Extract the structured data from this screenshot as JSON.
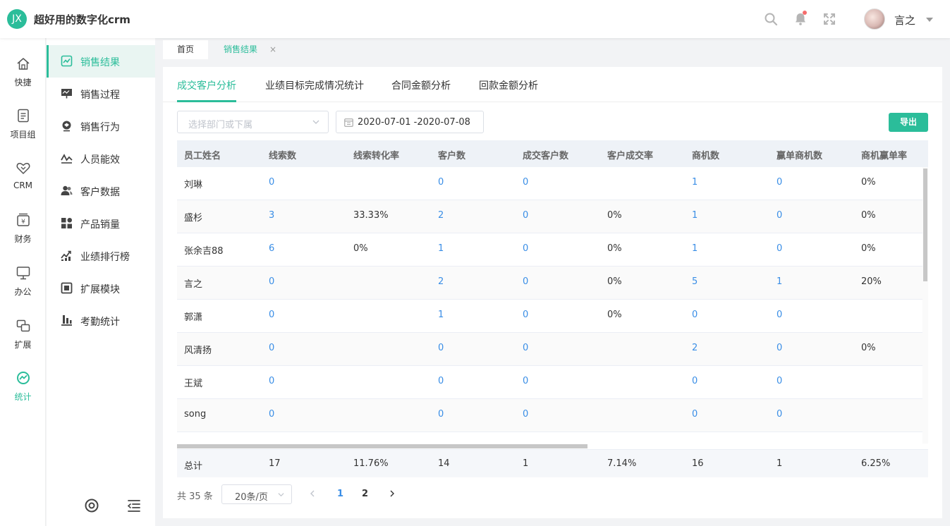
{
  "header": {
    "logo_text": "JX",
    "app_title": "超好用的数字化crm",
    "user_name": "言之"
  },
  "nav_primary": [
    {
      "label": "快捷",
      "icon": "home-icon"
    },
    {
      "label": "项目组",
      "icon": "document-icon"
    },
    {
      "label": "CRM",
      "icon": "handshake-icon"
    },
    {
      "label": "财务",
      "icon": "wallet-icon"
    },
    {
      "label": "办公",
      "icon": "monitor-icon"
    },
    {
      "label": "扩展",
      "icon": "extend-icon"
    },
    {
      "label": "统计",
      "icon": "stats-icon",
      "active": true
    }
  ],
  "nav_secondary": [
    {
      "label": "销售结果",
      "icon": "sales-result-icon",
      "active": true
    },
    {
      "label": "销售过程",
      "icon": "sales-process-icon"
    },
    {
      "label": "销售行为",
      "icon": "sales-behavior-icon"
    },
    {
      "label": "人员能效",
      "icon": "efficiency-icon"
    },
    {
      "label": "客户数据",
      "icon": "customers-icon"
    },
    {
      "label": "产品销量",
      "icon": "products-icon"
    },
    {
      "label": "业绩排行榜",
      "icon": "ranking-icon"
    },
    {
      "label": "扩展模块",
      "icon": "module-icon"
    },
    {
      "label": "考勤统计",
      "icon": "attendance-icon"
    }
  ],
  "page_tabs": [
    {
      "label": "首页"
    },
    {
      "label": "销售结果",
      "closable": true,
      "close_label": "×",
      "active": true
    }
  ],
  "tabs": [
    {
      "label": "成交客户分析",
      "active": true
    },
    {
      "label": "业绩目标完成情况统计"
    },
    {
      "label": "合同金额分析"
    },
    {
      "label": "回款金额分析"
    }
  ],
  "filters": {
    "department_placeholder": "选择部门或下属",
    "date_range": "2020-07-01 -2020-07-08",
    "export_label": "导出"
  },
  "table": {
    "columns": [
      "员工姓名",
      "线索数",
      "线索转化率",
      "客户数",
      "成交客户数",
      "客户成交率",
      "商机数",
      "赢单商机数",
      "商机赢单率"
    ],
    "rows": [
      [
        "刘琳",
        "0",
        "",
        "0",
        "0",
        "",
        "1",
        "0",
        "0%"
      ],
      [
        "盛杉",
        "3",
        "33.33%",
        "2",
        "0",
        "0%",
        "1",
        "0",
        "0%"
      ],
      [
        "张余吉88",
        "6",
        "0%",
        "1",
        "0",
        "0%",
        "1",
        "0",
        "0%"
      ],
      [
        "言之",
        "0",
        "",
        "2",
        "0",
        "0%",
        "5",
        "1",
        "20%"
      ],
      [
        "郭潇",
        "0",
        "",
        "1",
        "0",
        "0%",
        "0",
        "0",
        ""
      ],
      [
        "风清扬",
        "0",
        "",
        "0",
        "0",
        "",
        "2",
        "0",
        "0%"
      ],
      [
        "王斌",
        "0",
        "",
        "0",
        "0",
        "",
        "0",
        "0",
        ""
      ],
      [
        "song",
        "0",
        "",
        "0",
        "0",
        "",
        "0",
        "0",
        ""
      ]
    ],
    "total": [
      "总计",
      "17",
      "11.76%",
      "14",
      "1",
      "7.14%",
      "16",
      "1",
      "6.25%"
    ]
  },
  "pagination": {
    "total_text": "共 35 条",
    "page_size": "20条/页",
    "pages": [
      "1",
      "2"
    ],
    "current_page": "1"
  },
  "colors": {
    "accent": "#2bbd9a",
    "link": "#3a8ee6"
  }
}
